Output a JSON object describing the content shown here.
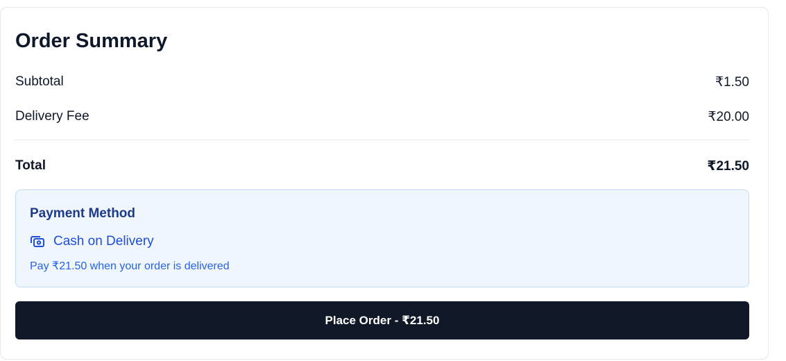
{
  "summary": {
    "title": "Order Summary",
    "subtotal_label": "Subtotal",
    "subtotal_value": "₹1.50",
    "delivery_label": "Delivery Fee",
    "delivery_value": "₹20.00",
    "total_label": "Total",
    "total_value": "₹21.50"
  },
  "payment": {
    "title": "Payment Method",
    "method_icon": "cash-icon",
    "method_label": "Cash on Delivery",
    "note": "Pay ₹21.50 when your order is delivered"
  },
  "actions": {
    "place_order_label": "Place Order - ₹21.50"
  },
  "colors": {
    "button_bg": "#111827",
    "payment_bg": "#eff6ff",
    "payment_border": "#bfdbfe",
    "payment_accent": "#1d4ed8"
  }
}
